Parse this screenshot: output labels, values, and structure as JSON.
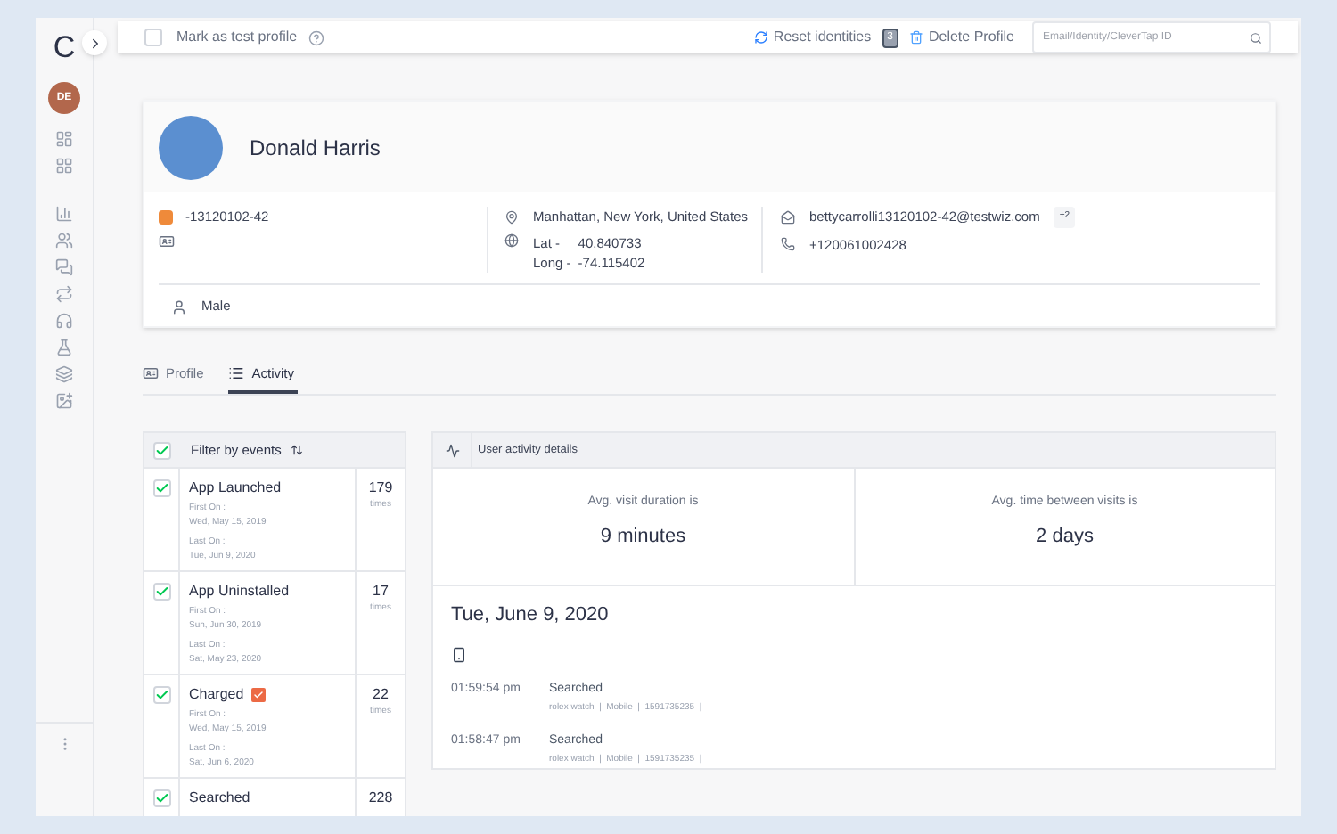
{
  "sidebar": {
    "logo": "C",
    "avatar": "DE"
  },
  "top_bar": {
    "test_profile": {
      "label": "Mark as test profile",
      "checked": false
    },
    "reset": {
      "label": "Reset identities",
      "count": "3"
    },
    "delete": {
      "label": "Delete Profile"
    },
    "search": {
      "placeholder": "Email/Identity/CleverTap ID"
    }
  },
  "profile": {
    "name": "Donald Harris",
    "identity": "-13120102-42",
    "location": "Manhattan, New York, United States",
    "lat_label": "Lat -",
    "lat": "40.840733",
    "long_label": "Long -",
    "long": "-74.115402",
    "email": "bettycarrolli13120102-42@testwiz.com",
    "email_more": "+2",
    "phone": "+120061002428",
    "gender": "Male"
  },
  "tabs": [
    {
      "label": "Profile",
      "selected": false
    },
    {
      "label": "Activity",
      "selected": true
    }
  ],
  "filter": {
    "title": "Filter by events",
    "checked": true,
    "events": [
      {
        "name": "App Launched",
        "checked": true,
        "flagged": false,
        "first_label": "First On :",
        "first": "Wed, May 15, 2019",
        "last_label": "Last On :",
        "last": "Tue, Jun 9, 2020",
        "count": "179",
        "unit": "times"
      },
      {
        "name": "App Uninstalled",
        "checked": true,
        "flagged": false,
        "first_label": "First On :",
        "first": "Sun, Jun 30, 2019",
        "last_label": "Last On :",
        "last": "Sat, May 23, 2020",
        "count": "17",
        "unit": "times"
      },
      {
        "name": "Charged",
        "checked": true,
        "flagged": true,
        "first_label": "First On :",
        "first": "Wed, May 15, 2019",
        "last_label": "Last On :",
        "last": "Sat, Jun 6, 2020",
        "count": "22",
        "unit": "times"
      },
      {
        "name": "Searched",
        "checked": true,
        "flagged": false,
        "count": "228"
      }
    ]
  },
  "activity": {
    "title": "User activity details",
    "stats": [
      {
        "label": "Avg. visit duration is",
        "value": "9 minutes"
      },
      {
        "label": "Avg. time between visits is",
        "value": "2 days"
      }
    ],
    "date": "Tue, June 9, 2020",
    "entries": [
      {
        "time": "01:59:54 pm",
        "event": "Searched",
        "details": "rolex watch  |  Mobile  |  1591735235  |"
      },
      {
        "time": "01:58:47 pm",
        "event": "Searched",
        "details": "rolex watch  |  Mobile  |  1591735235  |"
      }
    ]
  }
}
